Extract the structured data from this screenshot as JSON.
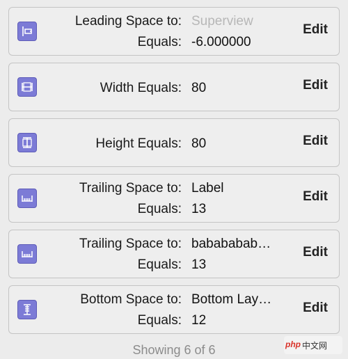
{
  "constraints": [
    {
      "icon": "leading-space-icon",
      "line1_label": "Leading Space to:",
      "line1_value": "Superview",
      "line1_value_gray": true,
      "line2_label": "Equals:",
      "line2_value": "-6.000000",
      "edit": "Edit"
    },
    {
      "icon": "width-icon",
      "line1_label": "Width Equals:",
      "line1_value": "80",
      "edit": "Edit"
    },
    {
      "icon": "height-icon",
      "line1_label": "Height Equals:",
      "line1_value": "80",
      "edit": "Edit"
    },
    {
      "icon": "trailing-space-icon",
      "line1_label": "Trailing Space to:",
      "line1_value": "Label",
      "line2_label": "Equals:",
      "line2_value": "13",
      "edit": "Edit"
    },
    {
      "icon": "trailing-space-icon",
      "line1_label": "Trailing Space to:",
      "line1_value": "babababab…",
      "line2_label": "Equals:",
      "line2_value": "13",
      "edit": "Edit"
    },
    {
      "icon": "bottom-space-icon",
      "line1_label": "Bottom Space to:",
      "line1_value": "Bottom Lay…",
      "line2_label": "Equals:",
      "line2_value": "12",
      "edit": "Edit"
    }
  ],
  "footer": "Showing 6 of 6",
  "watermark": {
    "php": "php",
    "cn": "中文网"
  }
}
